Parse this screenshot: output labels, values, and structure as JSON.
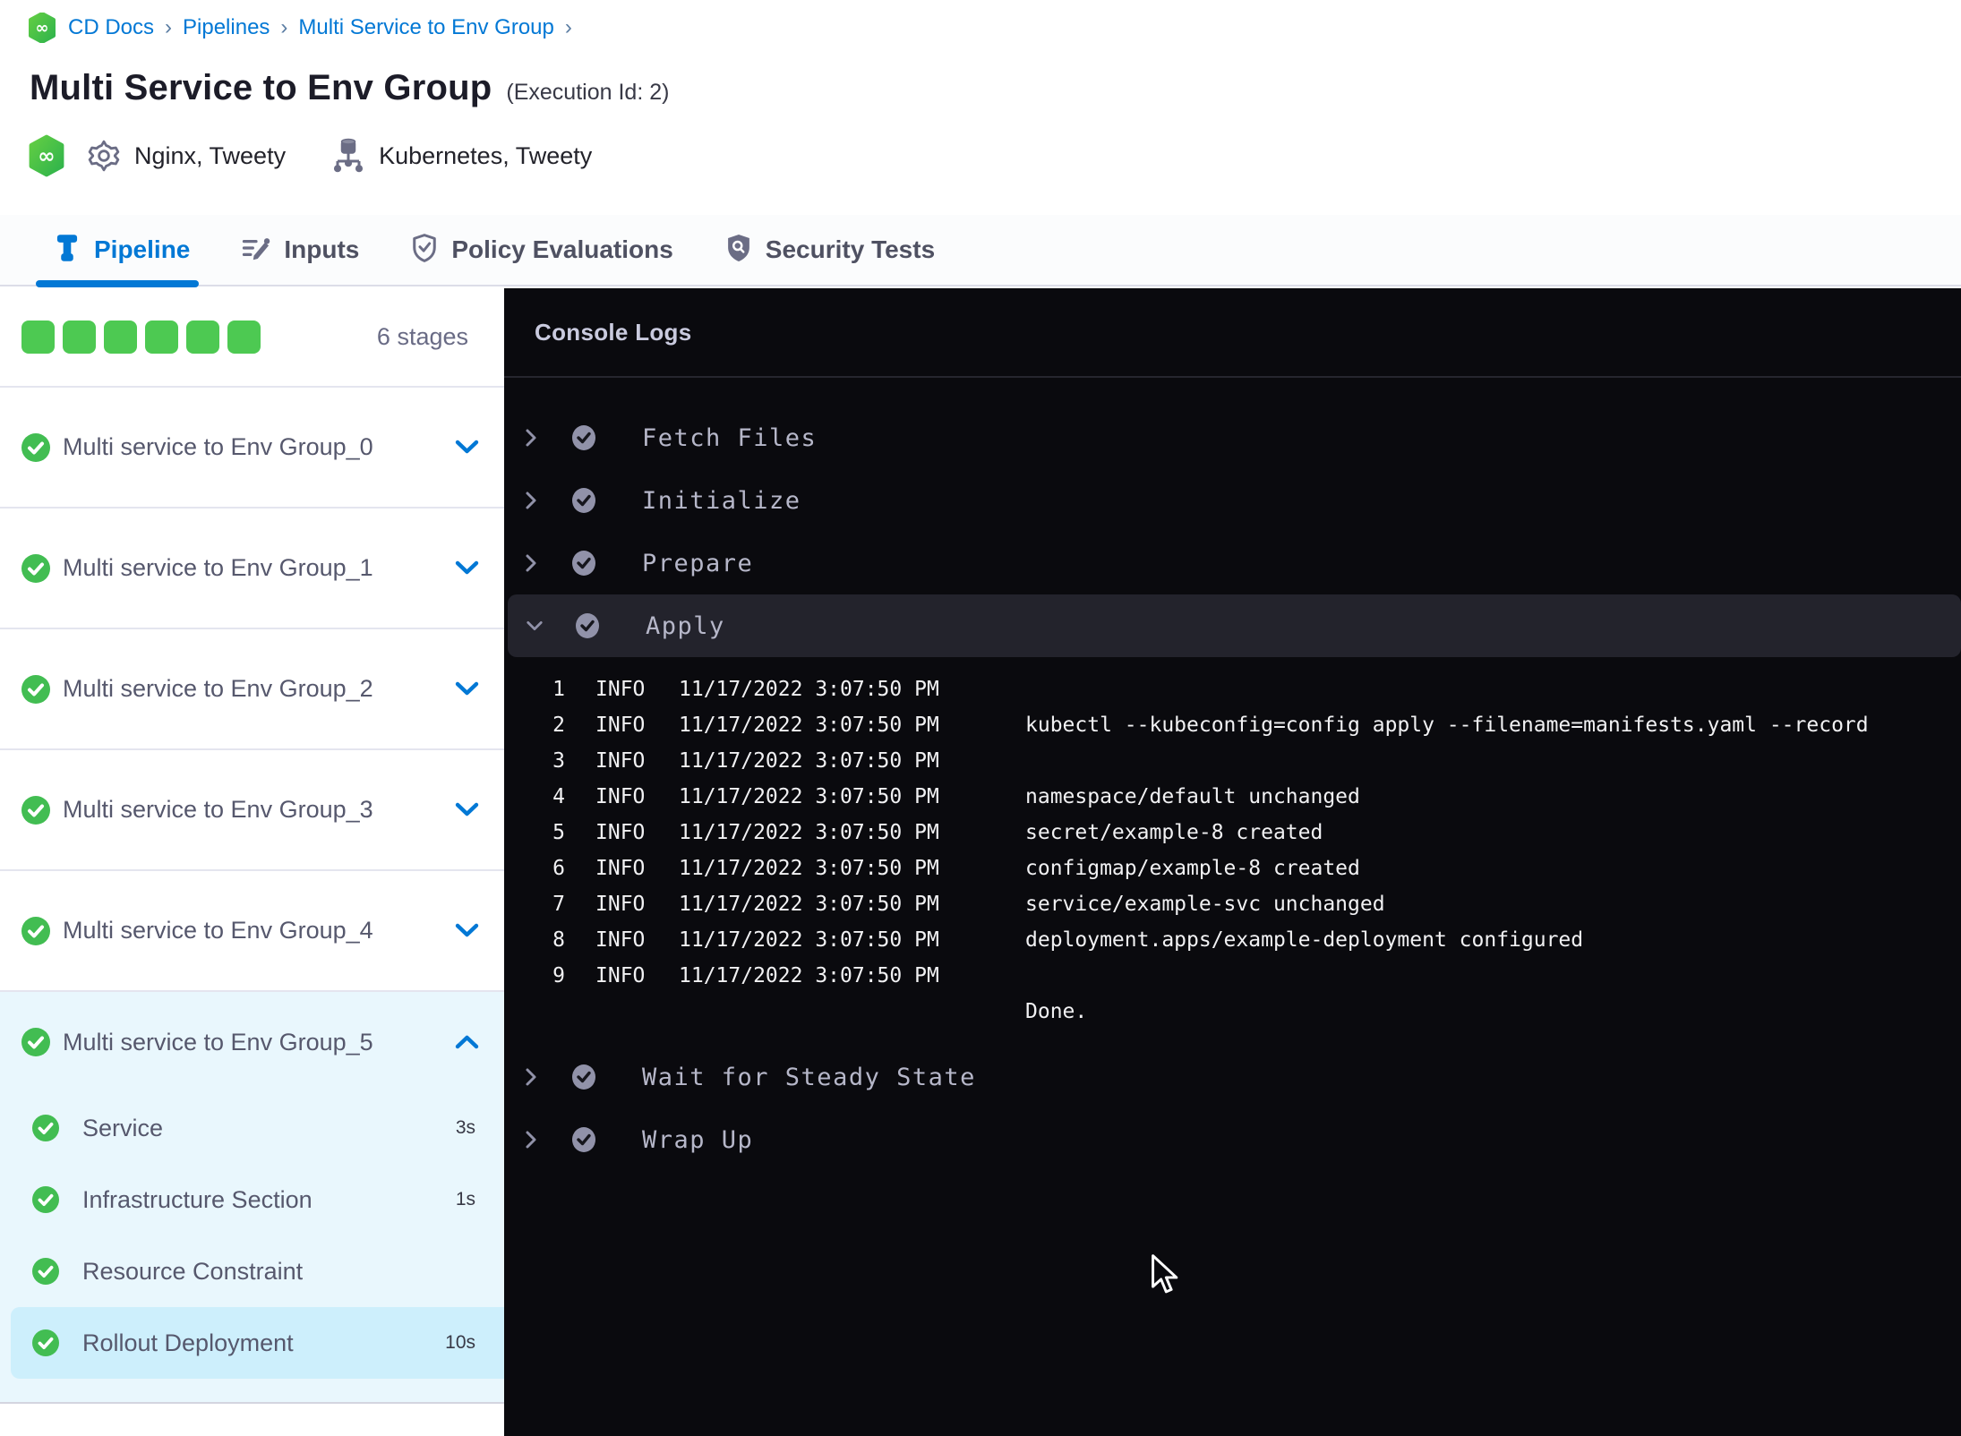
{
  "colors": {
    "accent": "#0278d5",
    "green": "#42bd52",
    "square_green": "#4dc952",
    "console_bg": "#0a0a0e",
    "highlight_dark": "#23232c",
    "light_blue": "#e9f7fd",
    "selected_blue": "#cdeffc",
    "text_dark": "#1c1c28",
    "border": "#e4e5ef",
    "console_border": "#26262e"
  },
  "breadcrumb": {
    "items": [
      "CD Docs",
      "Pipelines",
      "Multi Service to Env Group"
    ],
    "separator": "›"
  },
  "header": {
    "title": "Multi Service to Env Group",
    "execution_id": "(Execution Id: 2)",
    "services": "Nginx, Tweety",
    "environments": "Kubernetes, Tweety"
  },
  "tabs": [
    {
      "label": "Pipeline",
      "icon": "pipeline-icon",
      "active": true
    },
    {
      "label": "Inputs",
      "icon": "inputs-icon",
      "active": false
    },
    {
      "label": "Policy Evaluations",
      "icon": "policy-evaluations-icon",
      "active": false
    },
    {
      "label": "Security Tests",
      "icon": "security-tests-icon",
      "active": false
    }
  ],
  "sidebar": {
    "stage_count_label": "6 stages",
    "square_count": 6,
    "stages": [
      {
        "name": "Multi service to Env Group_0",
        "expanded": false
      },
      {
        "name": "Multi service to Env Group_1",
        "expanded": false
      },
      {
        "name": "Multi service to Env Group_2",
        "expanded": false
      },
      {
        "name": "Multi service to Env Group_3",
        "expanded": false
      },
      {
        "name": "Multi service to Env Group_4",
        "expanded": false
      },
      {
        "name": "Multi service to Env Group_5",
        "expanded": true,
        "steps": [
          {
            "name": "Service",
            "duration": "3s",
            "selected": false
          },
          {
            "name": "Infrastructure Section",
            "duration": "1s",
            "selected": false
          },
          {
            "name": "Resource Constraint",
            "duration": "",
            "selected": false
          },
          {
            "name": "Rollout Deployment",
            "duration": "10s",
            "selected": true
          }
        ]
      }
    ]
  },
  "console": {
    "title": "Console Logs",
    "sections": [
      {
        "label": "Fetch Files",
        "expanded": false
      },
      {
        "label": "Initialize",
        "expanded": false
      },
      {
        "label": "Prepare",
        "expanded": false
      },
      {
        "label": "Apply",
        "expanded": true
      },
      {
        "label": "Wait for Steady State",
        "expanded": false
      },
      {
        "label": "Wrap Up",
        "expanded": false
      }
    ],
    "logs": [
      {
        "num": "1",
        "level": "INFO",
        "time": "11/17/2022 3:07:50 PM",
        "msg": ""
      },
      {
        "num": "2",
        "level": "INFO",
        "time": "11/17/2022 3:07:50 PM",
        "msg": "kubectl --kubeconfig=config apply --filename=manifests.yaml --record"
      },
      {
        "num": "3",
        "level": "INFO",
        "time": "11/17/2022 3:07:50 PM",
        "msg": ""
      },
      {
        "num": "4",
        "level": "INFO",
        "time": "11/17/2022 3:07:50 PM",
        "msg": "namespace/default unchanged"
      },
      {
        "num": "5",
        "level": "INFO",
        "time": "11/17/2022 3:07:50 PM",
        "msg": "secret/example-8 created"
      },
      {
        "num": "6",
        "level": "INFO",
        "time": "11/17/2022 3:07:50 PM",
        "msg": "configmap/example-8 created"
      },
      {
        "num": "7",
        "level": "INFO",
        "time": "11/17/2022 3:07:50 PM",
        "msg": "service/example-svc unchanged"
      },
      {
        "num": "8",
        "level": "INFO",
        "time": "11/17/2022 3:07:50 PM",
        "msg": "deployment.apps/example-deployment configured"
      },
      {
        "num": "9",
        "level": "INFO",
        "time": "11/17/2022 3:07:50 PM",
        "msg": ""
      },
      {
        "num": "",
        "level": "",
        "time": "",
        "msg": "Done."
      }
    ]
  }
}
